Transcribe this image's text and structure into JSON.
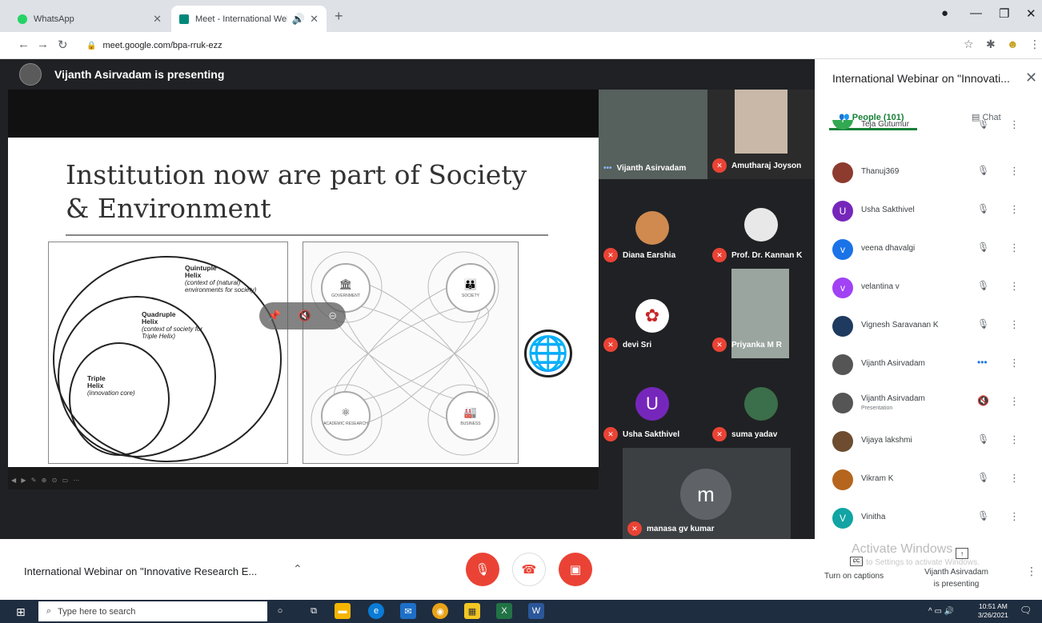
{
  "browser": {
    "tabs": [
      {
        "title": "WhatsApp",
        "active": false,
        "favicon_color": "#25d366"
      },
      {
        "title": "Meet - International Webina",
        "active": true,
        "favicon_color": "#00897b"
      }
    ],
    "url": "meet.google.com/bpa-rruk-ezz"
  },
  "meeting": {
    "presenter_banner": "Vijanth Asirvadam is presenting",
    "title": "International Webinar on \"Innovative Research E...",
    "panel_title": "International Webinar on \"Innovati...",
    "tabs": {
      "people": "People (101)",
      "chat": "Chat"
    }
  },
  "slide": {
    "title_line1": "Institution now are part of Society",
    "title_line2": "& Environment",
    "helix": {
      "quintuple_title": "Quintuple",
      "quintuple_sub": "Helix",
      "quintuple_desc": "(context of (natural) environments for society)",
      "quadruple_title": "Quadruple",
      "quadruple_sub": "Helix",
      "quadruple_desc": "(context of society for Triple Helix)",
      "triple_title": "Triple",
      "triple_sub": "Helix",
      "triple_desc": "(innovation core)"
    },
    "quad_nodes": [
      "GOVERNMENT",
      "SOCIETY",
      "ACADEMIC RESEARCH",
      "BUSINESS"
    ]
  },
  "tiles": [
    {
      "name": "Vijanth Asirvadam",
      "status": "speaking"
    },
    {
      "name": "Amutharaj Joyson",
      "status": "muted"
    },
    {
      "name": "Diana Earshia",
      "status": "muted"
    },
    {
      "name": "Prof. Dr. Kannan K",
      "status": "muted"
    },
    {
      "name": "devi Sri",
      "status": "muted"
    },
    {
      "name": "Priyanka M R",
      "status": "muted"
    },
    {
      "name": "Usha Sakthivel",
      "status": "muted",
      "initial": "U",
      "color": "#7627bb"
    },
    {
      "name": "suma yadav",
      "status": "muted"
    },
    {
      "name": "manasa gv kumar",
      "status": "muted",
      "initial": "m",
      "color": "#5f6368"
    }
  ],
  "people": [
    {
      "name": "Teja Gutumur",
      "initial": "T",
      "color": "#33a852"
    },
    {
      "name": "Thanuj369",
      "initial": "",
      "color": "#8d3b2e"
    },
    {
      "name": "Usha Sakthivel",
      "initial": "U",
      "color": "#7627bb"
    },
    {
      "name": "veena dhavalgi",
      "initial": "v",
      "color": "#1a73e8"
    },
    {
      "name": "velantina v",
      "initial": "v",
      "color": "#a142f4"
    },
    {
      "name": "Vignesh Saravanan K",
      "initial": "",
      "color": "#1e3a5f"
    },
    {
      "name": "Vijanth Asirvadam",
      "initial": "",
      "color": "#555555"
    },
    {
      "name": "Vijanth Asirvadam",
      "sub": "Presentation",
      "initial": "",
      "color": "#555555"
    },
    {
      "name": "Vijaya lakshmi",
      "initial": "",
      "color": "#6d4c2f"
    },
    {
      "name": "Vikram K",
      "initial": "",
      "color": "#b5651d"
    },
    {
      "name": "Vinitha",
      "initial": "V",
      "color": "#12a4a4"
    }
  ],
  "bottom": {
    "activate_title": "Activate Windows",
    "activate_sub": "Go to Settings to activate Windows.",
    "captions": "Turn on captions",
    "present_line1": "Vijanth Asirvadam",
    "present_line2": "is presenting"
  },
  "taskbar": {
    "search_placeholder": "Type here to search",
    "time": "10:51 AM",
    "date": "3/26/2021"
  },
  "colors": {
    "end_call": "#ea4335",
    "accent_green": "#188038"
  }
}
